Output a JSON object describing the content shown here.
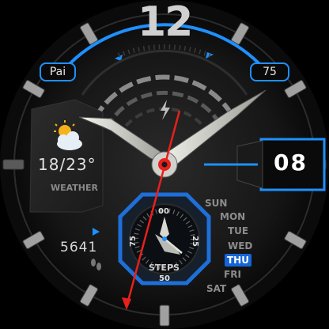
{
  "hour_marker": "12",
  "top_left_badge": "Pai",
  "top_right_badge": "75",
  "date_value": "08",
  "weather": {
    "icon": "partly-cloudy-icon",
    "temperature": "18/23°",
    "label": "WEATHER"
  },
  "steps": {
    "count": "5641",
    "arrow_icon": "play-triangle-icon",
    "footprint_icon": "footprints-icon"
  },
  "subdial": {
    "label": "STEPS",
    "top": "00",
    "right": "25",
    "bottom": "50",
    "left": "75"
  },
  "charging_icon": "lightning-bolt-icon",
  "weekdays": [
    "SUN",
    "MON",
    "TUE",
    "WED",
    "THU",
    "FRI",
    "SAT"
  ],
  "active_day": "THU",
  "colors": {
    "accent": "#1e90ff",
    "second_hand": "#e8201c",
    "hands": "#d8d8d0",
    "active_day_bg": "#1565d8"
  }
}
